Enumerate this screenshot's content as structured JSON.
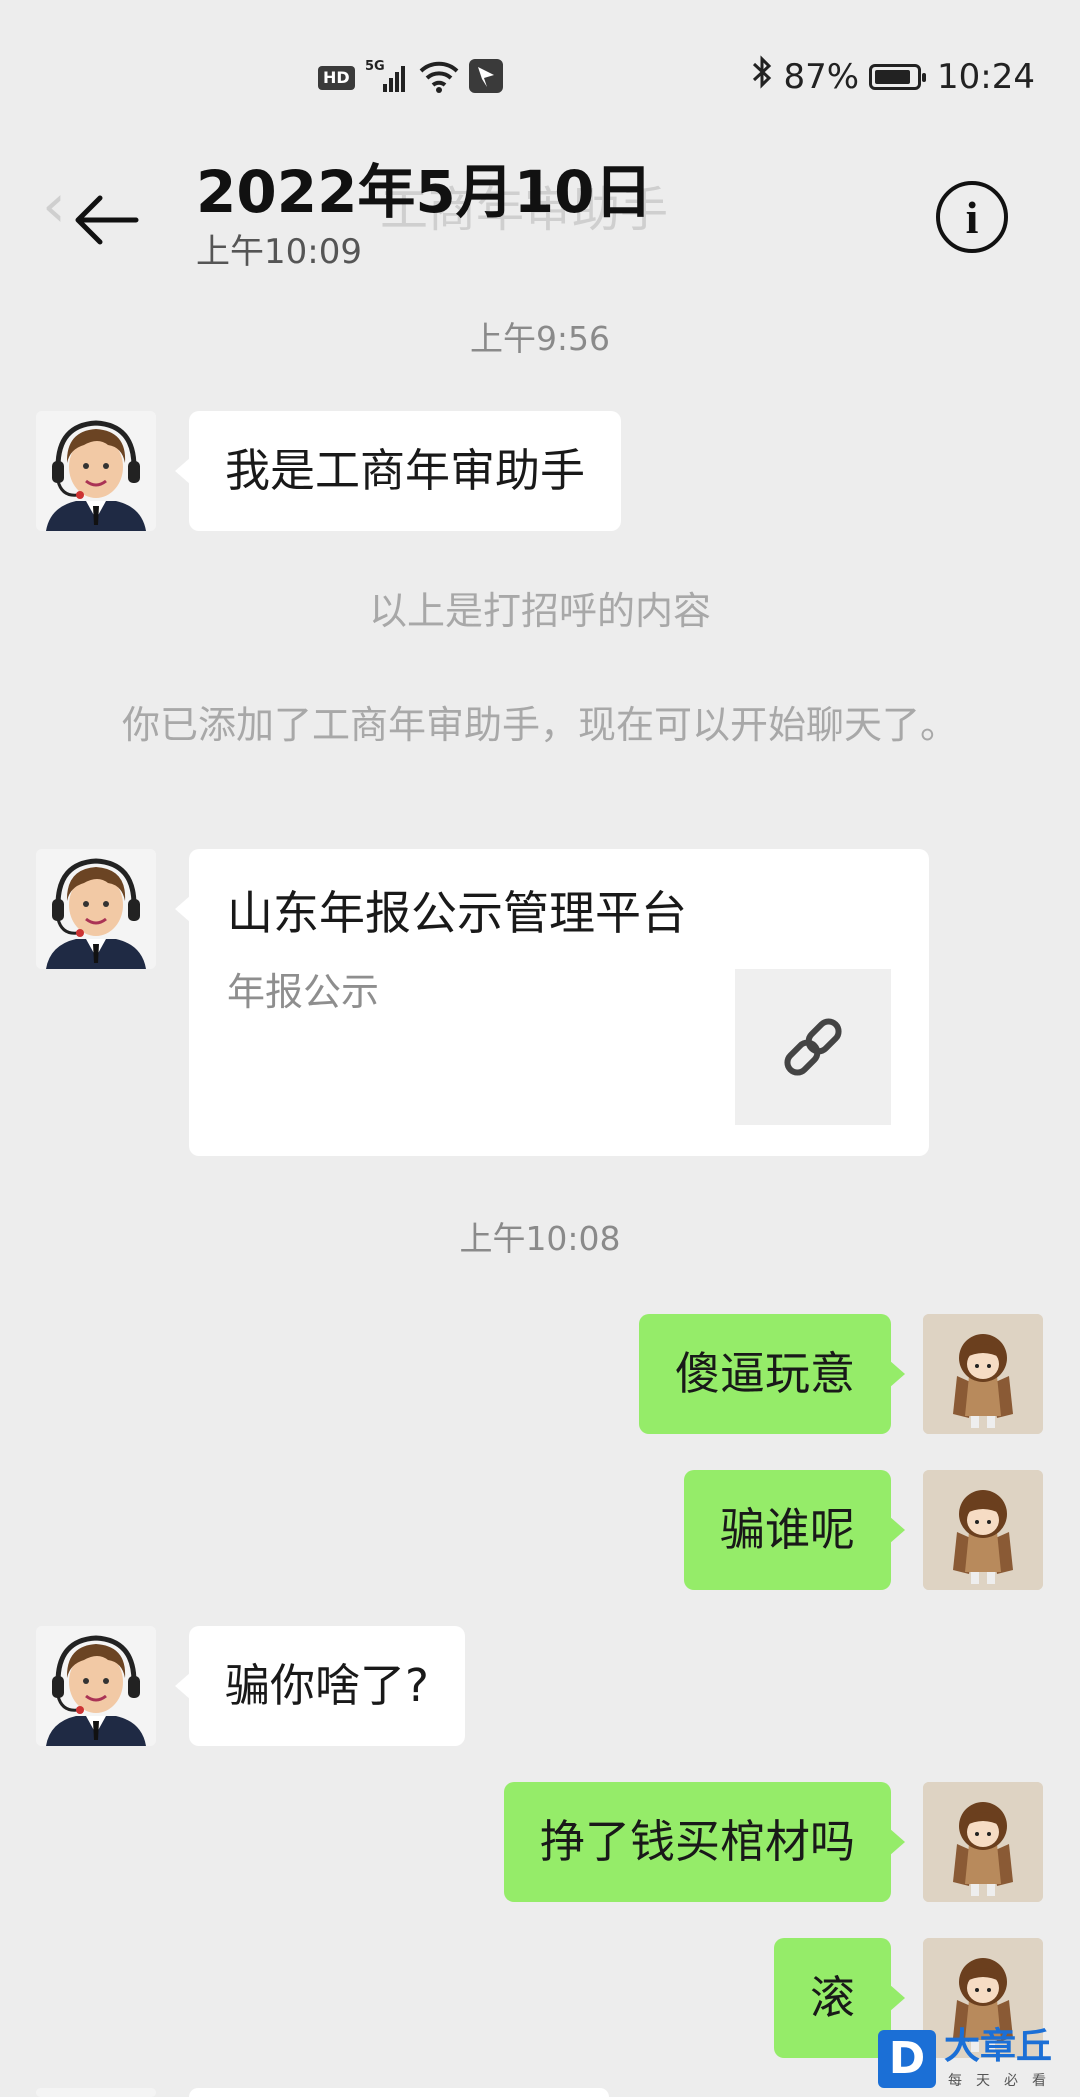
{
  "status_bar": {
    "hd": "HD",
    "network": "5G",
    "battery_percent": "87%",
    "battery_level": 0.87,
    "time": "10:24",
    "icons": [
      "hd-icon",
      "signal-5g-icon",
      "wifi-icon",
      "app-notification-icon",
      "bluetooth-icon",
      "battery-icon"
    ]
  },
  "header": {
    "ghost_title": "工商年审助手",
    "title": "2022年5月10日",
    "subtitle": "上午10:09",
    "back_icon": "arrow-left-icon",
    "info_icon": "info-circle-icon"
  },
  "messages": {
    "ts1": "上午9:56",
    "m1": "我是工商年审助手",
    "sys1": "以上是打招呼的内容",
    "sys2": "你已添加了工商年审助手，现在可以开始聊天了。",
    "card": {
      "title": "山东年报公示管理平台",
      "subtitle": "年报公示",
      "icon": "link-icon"
    },
    "ts2": "上午10:08",
    "m2": "傻逼玩意",
    "m3": "骗谁呢",
    "m4": "骗你啥了?",
    "m5": "挣了钱买棺材吗",
    "m6": "滚"
  },
  "watermark": {
    "letter": "D",
    "brand": "大章丘",
    "slogan": "每天必看"
  },
  "colors": {
    "background": "#ededed",
    "incoming_bubble": "#ffffff",
    "outgoing_bubble": "#95ec69",
    "timestamp": "#8a8a8a",
    "system_text": "#a8a8a8",
    "watermark": "#1b6fd6"
  }
}
